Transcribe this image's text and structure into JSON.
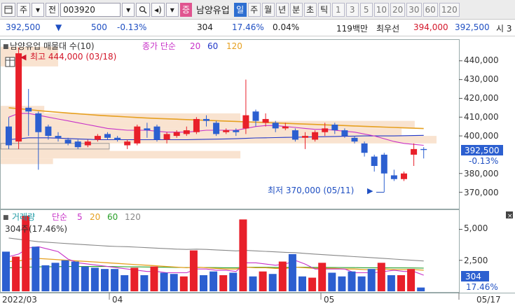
{
  "toolbar": {
    "type_label": "주",
    "mode_label": "전",
    "code_value": "003920",
    "name_badge": "증",
    "stock_name": "남양유업",
    "periods": [
      "일",
      "주",
      "월",
      "년",
      "분",
      "초",
      "틱"
    ],
    "active_period": "일",
    "numbers": [
      "1",
      "3",
      "5",
      "10",
      "20",
      "30",
      "60",
      "120"
    ]
  },
  "infobar": {
    "price": "392,500",
    "change": "500",
    "change_pct": "-0.13%",
    "volume": "304",
    "vol_ratio": "17.46%",
    "turnover_pct": "0.04%",
    "amount": "119백만",
    "bid_ask_label": "최우선",
    "ask": "394,000",
    "bid": "392,500",
    "cut_label": "시 3"
  },
  "price_panel": {
    "legend_name": "남양유업 매물대 수(10)",
    "legend_ma_label": "종가 단순",
    "ma_periods": [
      "20",
      "60",
      "120"
    ],
    "ma_colors": [
      "#c832c8",
      "#2238c8",
      "#e6a020"
    ],
    "high_annotation": "최고 444,000 (03/18)",
    "low_annotation": "최저 370,000 (05/11)",
    "y_ticks": [
      "440,000",
      "430,000",
      "420,000",
      "410,000",
      "400,000",
      "380,000",
      "370,000"
    ],
    "current_price": "392,500",
    "current_pct": "-0.13%"
  },
  "volume_panel": {
    "legend_name": "거래량",
    "legend_ma_label": "단순",
    "ma_periods": [
      "5",
      "20",
      "60",
      "120"
    ],
    "ma_colors": [
      "#c832c8",
      "#e6a020",
      "#2aa02a",
      "#888888"
    ],
    "last_label": "304주(17.46%)",
    "y_ticks": [
      "5,000",
      "2,500"
    ],
    "current_volume": "304",
    "current_pct": "17.46%"
  },
  "x_axis": {
    "labels": [
      "2022/03",
      "04",
      "05",
      "05/17"
    ]
  },
  "chart_data": [
    {
      "type": "candlestick",
      "title": "남양유업 일봉",
      "ylim": [
        362000,
        450000
      ],
      "up_color": "#e8202a",
      "down_color": "#2c5fd0",
      "candles": [
        {
          "o": 405000,
          "h": 410000,
          "c": 395000,
          "l": 393000
        },
        {
          "o": 397000,
          "h": 447000,
          "c": 444000,
          "l": 393000
        },
        {
          "o": 415000,
          "h": 425000,
          "c": 413000,
          "l": 400000
        },
        {
          "o": 412000,
          "h": 413000,
          "c": 402000,
          "l": 382000
        },
        {
          "o": 405000,
          "h": 406000,
          "c": 400000,
          "l": 398000
        },
        {
          "o": 400000,
          "h": 402000,
          "c": 399000,
          "l": 397000
        },
        {
          "o": 398000,
          "h": 399000,
          "c": 396000,
          "l": 395000
        },
        {
          "o": 397000,
          "h": 398000,
          "c": 394000,
          "l": 393000
        },
        {
          "o": 395000,
          "h": 398000,
          "c": 397000,
          "l": 394000
        },
        {
          "o": 398000,
          "h": 401000,
          "c": 400000,
          "l": 397000
        },
        {
          "o": 401000,
          "h": 402000,
          "c": 399000,
          "l": 398000
        },
        {
          "o": 399000,
          "h": 400000,
          "c": 398000,
          "l": 397000
        },
        {
          "o": 395000,
          "h": 398000,
          "c": 397000,
          "l": 393000
        },
        {
          "o": 396000,
          "h": 406000,
          "c": 405000,
          "l": 395000
        },
        {
          "o": 404000,
          "h": 407000,
          "c": 403000,
          "l": 399000
        },
        {
          "o": 405000,
          "h": 406000,
          "c": 398000,
          "l": 397000
        },
        {
          "o": 398000,
          "h": 402000,
          "c": 401000,
          "l": 396000
        },
        {
          "o": 400000,
          "h": 403000,
          "c": 402000,
          "l": 399000
        },
        {
          "o": 401000,
          "h": 405000,
          "c": 403000,
          "l": 400000
        },
        {
          "o": 402000,
          "h": 410000,
          "c": 409000,
          "l": 401000
        },
        {
          "o": 409000,
          "h": 411000,
          "c": 408000,
          "l": 405000
        },
        {
          "o": 407000,
          "h": 408000,
          "c": 401000,
          "l": 400000
        },
        {
          "o": 402000,
          "h": 404000,
          "c": 403000,
          "l": 401000
        },
        {
          "o": 403000,
          "h": 404000,
          "c": 402000,
          "l": 400000
        },
        {
          "o": 404000,
          "h": 430000,
          "c": 411000,
          "l": 401000
        },
        {
          "o": 413000,
          "h": 414000,
          "c": 408000,
          "l": 405000
        },
        {
          "o": 407000,
          "h": 412000,
          "c": 409000,
          "l": 405000
        },
        {
          "o": 407000,
          "h": 408000,
          "c": 404000,
          "l": 402000
        },
        {
          "o": 404000,
          "h": 407000,
          "c": 405000,
          "l": 403000
        },
        {
          "o": 403000,
          "h": 404000,
          "c": 398000,
          "l": 397000
        },
        {
          "o": 399000,
          "h": 402000,
          "c": 400000,
          "l": 393000
        },
        {
          "o": 398000,
          "h": 403000,
          "c": 402000,
          "l": 397000
        },
        {
          "o": 402000,
          "h": 407000,
          "c": 404000,
          "l": 400000
        },
        {
          "o": 406000,
          "h": 407000,
          "c": 403000,
          "l": 401000
        },
        {
          "o": 403000,
          "h": 404000,
          "c": 400000,
          "l": 399000
        },
        {
          "o": 399000,
          "h": 400000,
          "c": 397000,
          "l": 396000
        },
        {
          "o": 396000,
          "h": 397000,
          "c": 391000,
          "l": 389000
        },
        {
          "o": 389000,
          "h": 390000,
          "c": 384000,
          "l": 381000
        },
        {
          "o": 390000,
          "h": 391000,
          "c": 380000,
          "l": 370000
        },
        {
          "o": 379000,
          "h": 382000,
          "c": 377000,
          "l": 376000
        },
        {
          "o": 377000,
          "h": 381000,
          "c": 380000,
          "l": 376000
        },
        {
          "o": 390000,
          "h": 396000,
          "c": 393000,
          "l": 384000
        },
        {
          "o": 393000,
          "h": 394000,
          "c": 392500,
          "l": 388000
        }
      ],
      "ma20": [
        410000,
        412000,
        412000,
        411000,
        410000,
        409000,
        408000,
        407000,
        406000,
        405000,
        404000,
        403500,
        403000,
        403000,
        403000,
        402500,
        402000,
        402000,
        402000,
        402500,
        403000,
        403000,
        403000,
        403000,
        404000,
        405000,
        405500,
        405500,
        405000,
        404500,
        404000,
        403500,
        403500,
        403000,
        402500,
        402000,
        401000,
        400000,
        398500,
        397000,
        396000,
        395500,
        395000
      ],
      "ma60": [
        398000,
        398500,
        399000,
        399000,
        399000,
        398800,
        398600,
        398400,
        398200,
        398000,
        398000,
        398000,
        398000,
        398000,
        398000,
        398000,
        398000,
        398000,
        398000,
        398100,
        398200,
        398300,
        398400,
        398500,
        398700,
        398900,
        399000,
        399100,
        399200,
        399300,
        399400,
        399500,
        399600,
        399700,
        399800,
        399900,
        400000,
        400000,
        400000,
        400000,
        400100,
        400200,
        400300
      ],
      "ma120": [
        415000,
        414500,
        414000,
        413500,
        413000,
        412600,
        412200,
        411800,
        411400,
        411000,
        410700,
        410400,
        410100,
        409800,
        409500,
        409300,
        409100,
        408900,
        408700,
        408500,
        408300,
        408100,
        407900,
        407700,
        407500,
        407300,
        407100,
        406900,
        406700,
        406500,
        406300,
        406100,
        405900,
        405700,
        405500,
        405300,
        405100,
        404900,
        404700,
        404500,
        404300,
        404100,
        403900
      ],
      "volume_profile": [
        {
          "from": 385000,
          "to": 388000,
          "weight": 0.12
        },
        {
          "from": 388000,
          "to": 392000,
          "weight": 0.55
        },
        {
          "from": 392000,
          "to": 396000,
          "weight": 0.25
        },
        {
          "from": 396000,
          "to": 400000,
          "weight": 1.0
        },
        {
          "from": 400000,
          "to": 404000,
          "weight": 0.92
        },
        {
          "from": 404000,
          "to": 408000,
          "weight": 0.95
        },
        {
          "from": 408000,
          "to": 412000,
          "weight": 0.55
        },
        {
          "from": 412000,
          "to": 416000,
          "weight": 0.1
        }
      ]
    },
    {
      "type": "bar",
      "title": "거래량",
      "ylim": [
        0,
        6500
      ],
      "values": [
        3200,
        2800,
        6100,
        3600,
        2100,
        2300,
        2500,
        2400,
        2000,
        1900,
        1800,
        1800,
        1300,
        1900,
        1300,
        2000,
        1500,
        1400,
        1200,
        3300,
        1300,
        1600,
        1300,
        1500,
        5800,
        1200,
        1600,
        1400,
        2400,
        3000,
        1200,
        1100,
        2300,
        1500,
        1200,
        1600,
        1200,
        1800,
        2300,
        1300,
        1300,
        1800,
        304
      ],
      "up": [
        false,
        true,
        true,
        false,
        false,
        false,
        false,
        false,
        false,
        false,
        false,
        false,
        false,
        true,
        false,
        true,
        false,
        false,
        true,
        true,
        false,
        false,
        true,
        false,
        true,
        false,
        true,
        false,
        true,
        false,
        false,
        true,
        true,
        false,
        false,
        false,
        false,
        false,
        true,
        false,
        true,
        true,
        false
      ],
      "ma5": [
        2800,
        3000,
        3500,
        3600,
        3400,
        3200,
        2600,
        2300,
        2200,
        2100,
        2000,
        1900,
        1800,
        1700,
        1600,
        1600,
        1500,
        1500,
        1500,
        1800,
        1800,
        1700,
        1700,
        1600,
        2300,
        2300,
        2200,
        2100,
        2200,
        2500,
        2200,
        1800,
        1800,
        1800,
        1800,
        1500,
        1500,
        1500,
        1600,
        1700,
        1600,
        1600,
        1300
      ],
      "ma20": [
        2400,
        2450,
        2600,
        2650,
        2600,
        2550,
        2500,
        2450,
        2400,
        2350,
        2300,
        2250,
        2200,
        2150,
        2100,
        2050,
        2000,
        1950,
        1900,
        1950,
        1900,
        1850,
        1800,
        1800,
        1950,
        1900,
        1900,
        1850,
        1850,
        1950,
        1900,
        1850,
        1850,
        1850,
        1800,
        1800,
        1750,
        1750,
        1800,
        1750,
        1750,
        1750,
        1700
      ],
      "ma60": [
        1900,
        1920,
        1950,
        1970,
        1980,
        1990,
        2000,
        2000,
        2000,
        2000,
        2000,
        1990,
        1980,
        1970,
        1960,
        1950,
        1940,
        1930,
        1920,
        1930,
        1920,
        1910,
        1900,
        1900,
        1950,
        1940,
        1940,
        1930,
        1930,
        1950,
        1940,
        1930,
        1930,
        1920,
        1910,
        1910,
        1900,
        1900,
        1900,
        1890,
        1890,
        1880,
        1870
      ],
      "ma120": [
        4300,
        4200,
        4100,
        4000,
        3950,
        3900,
        3850,
        3800,
        3750,
        3700,
        3650,
        3620,
        3600,
        3560,
        3520,
        3480,
        3440,
        3400,
        3380,
        3400,
        3380,
        3340,
        3300,
        3260,
        3300,
        3260,
        3220,
        3180,
        3140,
        3120,
        3060,
        3000,
        2950,
        2900,
        2850,
        2800,
        2750,
        2700,
        2650,
        2600,
        2550,
        2500,
        2450
      ]
    }
  ]
}
